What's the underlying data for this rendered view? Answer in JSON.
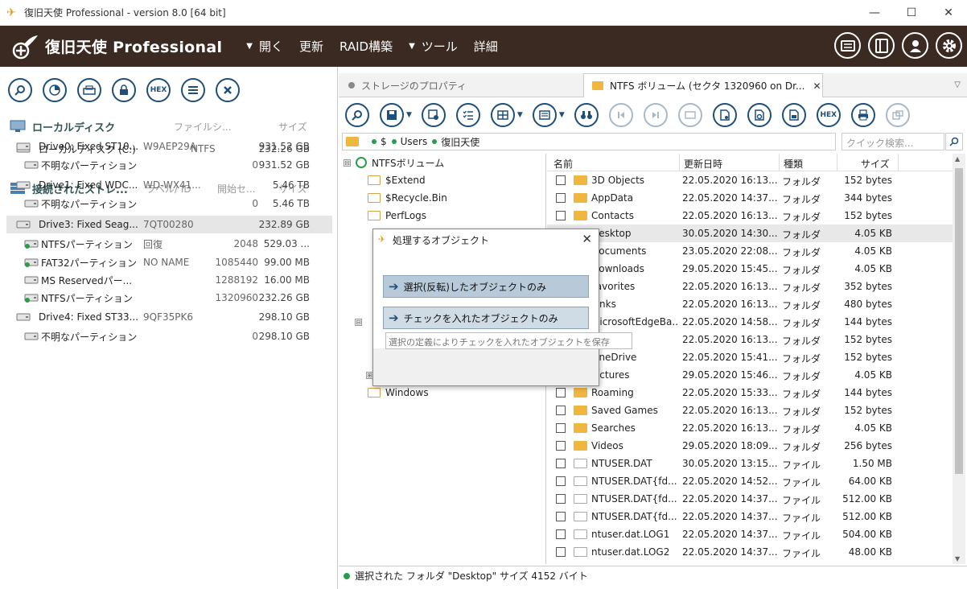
{
  "window": {
    "title": "復旧天使 Professional - version 8.0 [64 bit]",
    "minimize": "—",
    "maximize": "☐",
    "close": "✕"
  },
  "menubar": {
    "logo_text": "復旧天使 Professional",
    "items": [
      {
        "label": "開く",
        "caret": "▼"
      },
      {
        "label": "更新",
        "caret": ""
      },
      {
        "label": "RAID構築",
        "caret": ""
      },
      {
        "label": "ツール",
        "caret": "▼"
      },
      {
        "label": "詳細",
        "caret": ""
      }
    ],
    "right_icons": [
      "card-icon",
      "panel-icon",
      "user-icon",
      "gear-icon"
    ]
  },
  "left_toolbar": {
    "hex_label": "HEX"
  },
  "local_section": {
    "title": "ローカルディスク",
    "col_fs": "ファイルシ...",
    "col_size": "サイズ",
    "rows": [
      {
        "name": "ローカルディスク (C:)",
        "label": "NTFS",
        "start": "",
        "size": "232.26 GB"
      }
    ]
  },
  "storage_section": {
    "title": "接続されたストレ...",
    "col_label": "ラベル/ ID",
    "col_start": "開始セ...",
    "col_size": "サイズ",
    "rows": [
      {
        "name": "Drive0: Fixed ST10...",
        "label": "W9AEP29A",
        "start": "",
        "size": "931.52 GB"
      },
      {
        "name": "不明なパーティション",
        "label": "",
        "start": "0",
        "size": "931.52 GB"
      },
      {
        "name": "Drive1: Fixed WDC...",
        "label": "WD-WX41...",
        "start": "",
        "size": "5.46 TB"
      },
      {
        "name": "不明なパーティション",
        "label": "",
        "start": "0",
        "size": "5.46 TB"
      },
      {
        "name": "Drive3: Fixed Seag...",
        "label": "7QT00280",
        "start": "",
        "size": "232.89 GB"
      },
      {
        "name": "NTFSパーティション",
        "label": "回復",
        "start": "2048",
        "size": "529.03 ..."
      },
      {
        "name": "FAT32パーティション",
        "label": "NO NAME",
        "start": "1085440",
        "size": "99.00 MB"
      },
      {
        "name": "MS Reservedパー...",
        "label": "",
        "start": "1288192",
        "size": "16.00 MB"
      },
      {
        "name": "NTFSパーティション",
        "label": "",
        "start": "1320960",
        "size": "232.26 GB"
      },
      {
        "name": "Drive4: Fixed ST33...",
        "label": "9QF35PK6",
        "start": "",
        "size": "298.10 GB"
      },
      {
        "name": "不明なパーティション",
        "label": "",
        "start": "0",
        "size": "298.10 GB"
      }
    ]
  },
  "tabs": [
    {
      "label": "ストレージのプロパティ"
    },
    {
      "label": "NTFS ボリューム (セクタ 1320960 on Dr...",
      "close": "✕"
    }
  ],
  "right_toolbar": {
    "hex_label": "HEX"
  },
  "pathbar": {
    "segments": [
      "$",
      "Users",
      "復旧天使"
    ]
  },
  "search": {
    "placeholder": "クイック検索..."
  },
  "tree": {
    "root": "NTFSボリューム",
    "items": [
      "$Extend",
      "$Recycle.Bin",
      "PerfLogs",
      "Windows"
    ],
    "expand_symbol": "⊟",
    "collapse_symbol": "⊞"
  },
  "filelist": {
    "columns": {
      "name": "名前",
      "date": "更新日時",
      "type": "種類",
      "size": "サイズ"
    },
    "rows": [
      {
        "name": "3D Objects",
        "date": "22.05.2020 16:13...",
        "type": "フォルダ",
        "size": "152 bytes",
        "kind": "folder"
      },
      {
        "name": "AppData",
        "date": "22.05.2020 14:37...",
        "type": "フォルダ",
        "size": "344 bytes",
        "kind": "folder"
      },
      {
        "name": "Contacts",
        "date": "22.05.2020 16:13...",
        "type": "フォルダ",
        "size": "152 bytes",
        "kind": "folder"
      },
      {
        "name": "Desktop",
        "date": "30.05.2020 14:30...",
        "type": "フォルダ",
        "size": "4.05 KB",
        "kind": "folder"
      },
      {
        "name": "Documents",
        "date": "23.05.2020 22:08...",
        "type": "フォルダ",
        "size": "4.05 KB",
        "kind": "folder"
      },
      {
        "name": "Downloads",
        "date": "29.05.2020 15:45...",
        "type": "フォルダ",
        "size": "4.05 KB",
        "kind": "folder"
      },
      {
        "name": "Favorites",
        "date": "22.05.2020 16:13...",
        "type": "フォルダ",
        "size": "352 bytes",
        "kind": "folder"
      },
      {
        "name": "Links",
        "date": "22.05.2020 16:13...",
        "type": "フォルダ",
        "size": "480 bytes",
        "kind": "folder"
      },
      {
        "name": "MicrosoftEdgeBa...",
        "date": "22.05.2020 14:58...",
        "type": "フォルダ",
        "size": "144 bytes",
        "kind": "folder"
      },
      {
        "name": "Music",
        "date": "22.05.2020 16:13...",
        "type": "フォルダ",
        "size": "152 bytes",
        "kind": "folder"
      },
      {
        "name": "OneDrive",
        "date": "22.05.2020 15:41...",
        "type": "フォルダ",
        "size": "152 bytes",
        "kind": "folder"
      },
      {
        "name": "Pictures",
        "date": "29.05.2020 15:46...",
        "type": "フォルダ",
        "size": "4.05 KB",
        "kind": "folder"
      },
      {
        "name": "Roaming",
        "date": "22.05.2020 15:33...",
        "type": "フォルダ",
        "size": "144 bytes",
        "kind": "folder"
      },
      {
        "name": "Saved Games",
        "date": "22.05.2020 16:13...",
        "type": "フォルダ",
        "size": "152 bytes",
        "kind": "folder"
      },
      {
        "name": "Searches",
        "date": "22.05.2020 16:13...",
        "type": "フォルダ",
        "size": "4.05 KB",
        "kind": "folder"
      },
      {
        "name": "Videos",
        "date": "29.05.2020 18:09...",
        "type": "フォルダ",
        "size": "256 bytes",
        "kind": "folder"
      },
      {
        "name": "NTUSER.DAT",
        "date": "30.05.2020 13:15...",
        "type": "ファイル",
        "size": "1.50 MB",
        "kind": "file"
      },
      {
        "name": "NTUSER.DAT{fd...",
        "date": "22.05.2020 14:52...",
        "type": "ファイル",
        "size": "64.00 KB",
        "kind": "file"
      },
      {
        "name": "NTUSER.DAT{fd...",
        "date": "22.05.2020 14:37...",
        "type": "ファイル",
        "size": "512.00 KB",
        "kind": "file"
      },
      {
        "name": "NTUSER.DAT{fd...",
        "date": "22.05.2020 14:37...",
        "type": "ファイル",
        "size": "512.00 KB",
        "kind": "file"
      },
      {
        "name": "ntuser.dat.LOG1",
        "date": "22.05.2020 14:37...",
        "type": "ファイル",
        "size": "504.00 KB",
        "kind": "file"
      },
      {
        "name": "ntuser.dat.LOG2",
        "date": "22.05.2020 14:37...",
        "type": "ファイル",
        "size": "48.00 KB",
        "kind": "file"
      }
    ]
  },
  "statusbar": {
    "text": "選択された フォルダ \"Desktop\" サイズ 4152 バイト"
  },
  "dialog": {
    "title": "処理するオブジェクト",
    "close": "✕",
    "option1": "選択(反転)したオブジェクトのみ",
    "option2": "チェックを入れたオブジェクトのみ",
    "hint": "選択の定義によりチェックを入れたオブジェクトを保存",
    "arrow": "➔"
  },
  "colors": {
    "menubar_bg": "#3b2a22",
    "accent_blue": "#1e4f7a",
    "folder": "#f0b73f",
    "ok_green": "#2a9d4c"
  }
}
